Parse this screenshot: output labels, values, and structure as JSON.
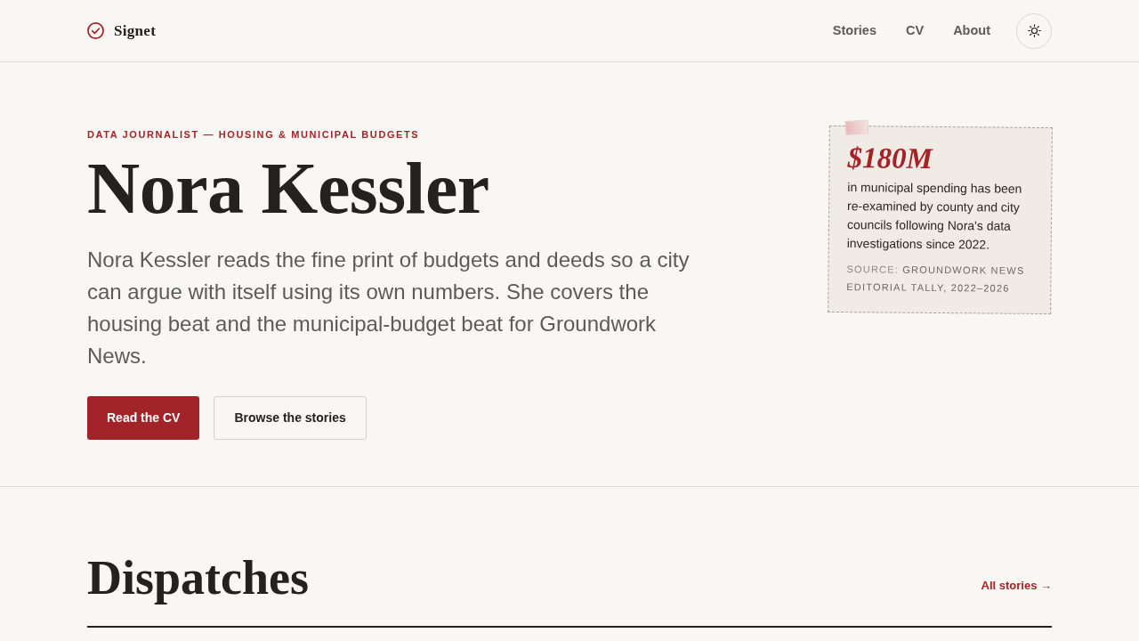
{
  "header": {
    "logo": "Signet",
    "nav": [
      {
        "label": "Stories"
      },
      {
        "label": "CV"
      },
      {
        "label": "About"
      }
    ]
  },
  "hero": {
    "eyebrow": "DATA JOURNALIST — HOUSING & MUNICIPAL BUDGETS",
    "name": "Nora Kessler",
    "intro": "Nora Kessler reads the fine print of budgets and deeds so a city can argue with itself using its own numbers. She covers the housing beat and the municipal-budget beat for Groundwork News.",
    "buttons": [
      {
        "label": "Read the CV",
        "kind": "primary"
      },
      {
        "label": "Browse the stories",
        "kind": "secondary"
      }
    ]
  },
  "stat_card": {
    "figure": "$180M",
    "text": "in municipal spending has been re-examined by county and city councils following Nora's data investigations since 2022.",
    "source_label": "SOURCE:",
    "source": "GROUNDWORK NEWS EDITORIAL TALLY, 2022–2026"
  },
  "dispatches": {
    "title": "Dispatches",
    "link": "All stories →"
  }
}
